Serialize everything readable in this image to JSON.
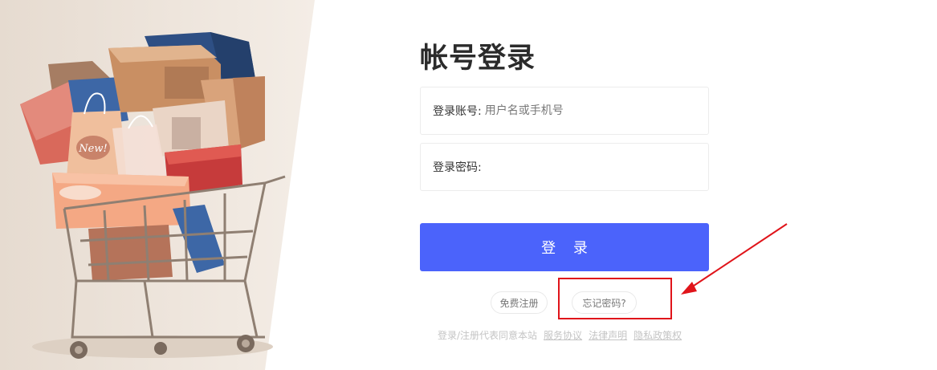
{
  "login": {
    "title": "帐号登录",
    "username_label": "登录账号:",
    "username_placeholder": "用户名或手机号",
    "username_value": "",
    "password_label": "登录密码:",
    "password_value": "",
    "submit_label": "登 录",
    "register_label": "免费注册",
    "forgot_label": "忘记密码?"
  },
  "legal": {
    "prefix": "登录/注册代表同意本站",
    "links": [
      "服务协议",
      "法律声明",
      "隐私政策权"
    ]
  },
  "colors": {
    "primary": "#4b63fb",
    "annotation": "#e0141a"
  },
  "icons": [
    "shopping-cart-illustration",
    "annotation-arrow"
  ]
}
